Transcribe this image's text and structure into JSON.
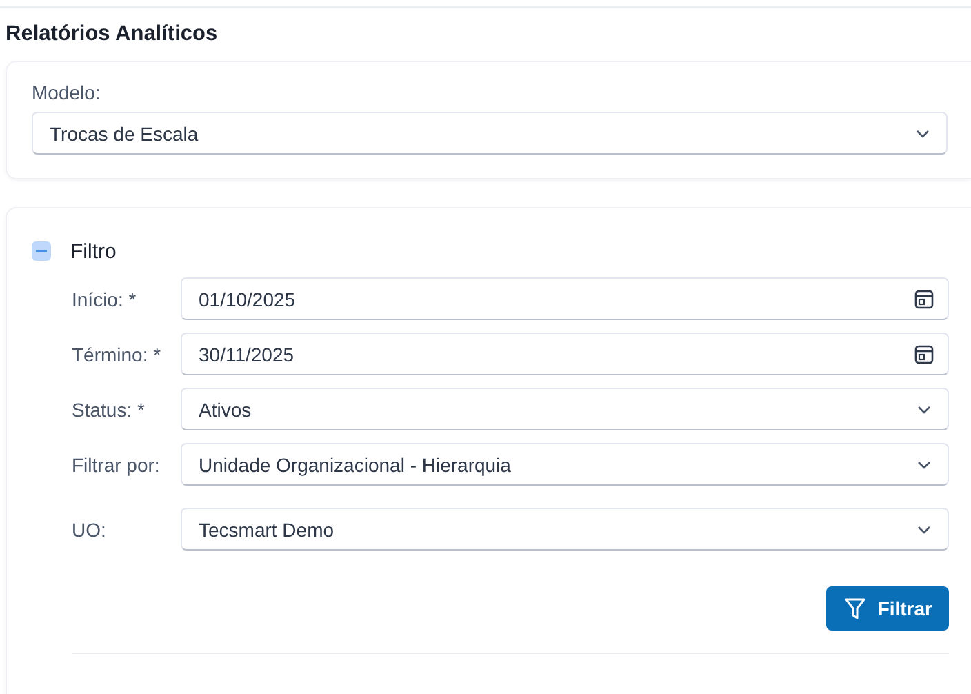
{
  "page_title": "Relatórios Analíticos",
  "model": {
    "label": "Modelo:",
    "value": "Trocas de Escala"
  },
  "filter": {
    "title": "Filtro",
    "expanded": true,
    "fields": [
      {
        "label": "Início: *",
        "value": "01/10/2025",
        "kind": "date",
        "spaced": false
      },
      {
        "label": "Término: *",
        "value": "30/11/2025",
        "kind": "date",
        "spaced": false
      },
      {
        "label": "Status: *",
        "value": "Ativos",
        "kind": "select",
        "spaced": false
      },
      {
        "label": "Filtrar por:",
        "value": "Unidade Organizacional - Hierarquia",
        "kind": "select",
        "spaced": false
      },
      {
        "label": "UO:",
        "value": "Tecsmart Demo",
        "kind": "select",
        "spaced": true
      }
    ],
    "button": "Filtrar"
  }
}
